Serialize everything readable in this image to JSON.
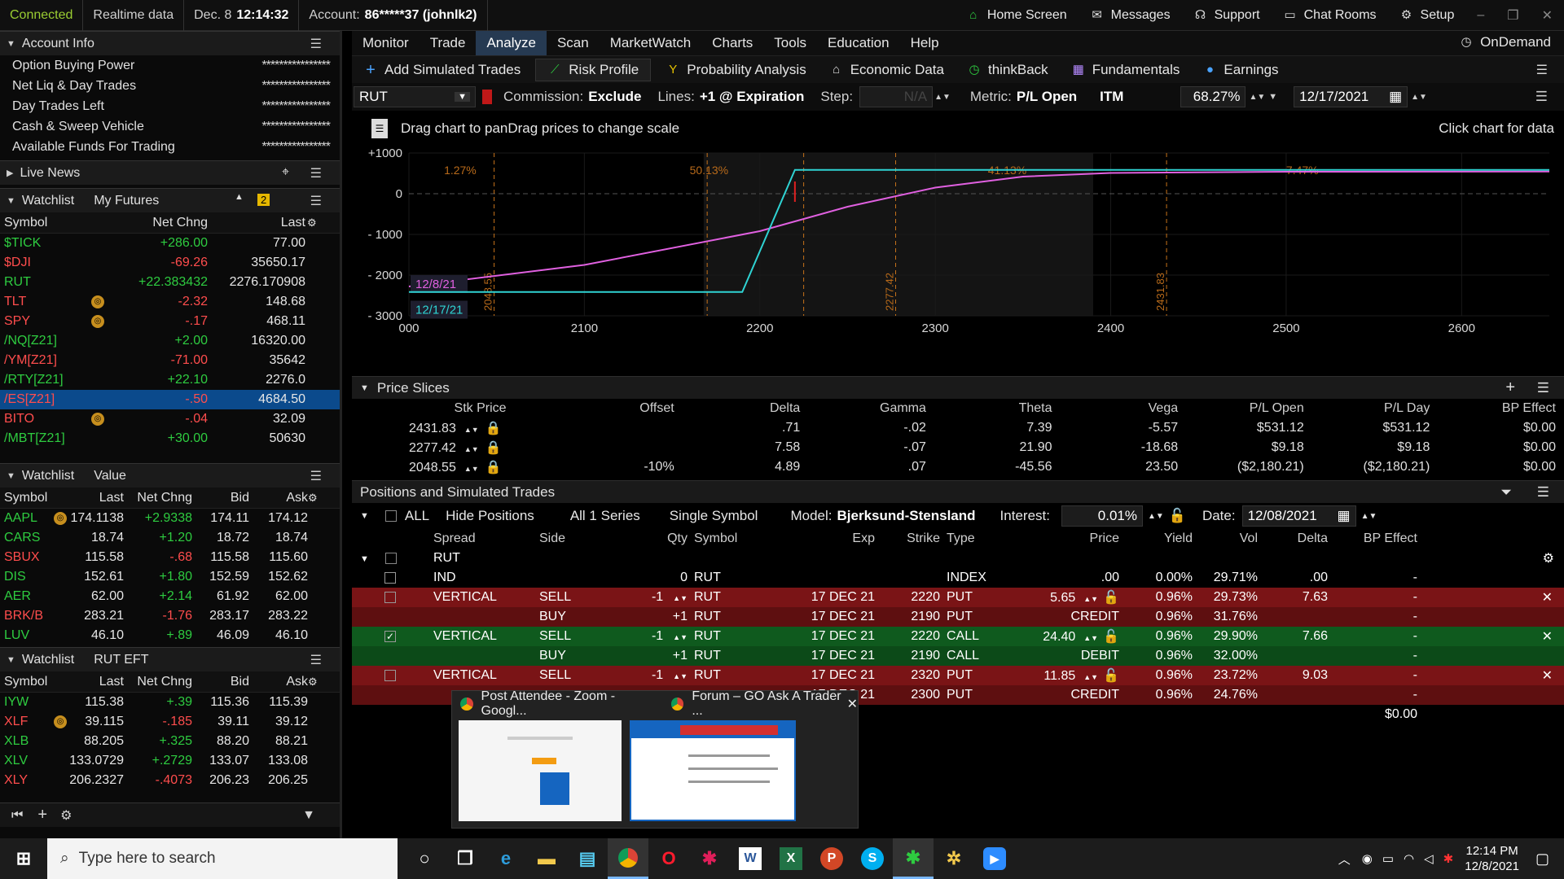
{
  "topbar": {
    "connected": "Connected",
    "realtime": "Realtime data",
    "date": "Dec. 8",
    "time": "12:14:32",
    "account_label": "Account:",
    "account_value": "86*****37 (johnlk2)",
    "home": "Home Screen",
    "messages": "Messages",
    "support": "Support",
    "chat": "Chat Rooms",
    "setup": "Setup"
  },
  "account": {
    "title": "Account Info",
    "rows": [
      {
        "label": "Option Buying Power",
        "value": "****************"
      },
      {
        "label": "Net Liq & Day Trades",
        "value": "****************"
      },
      {
        "label": "Day Trades Left",
        "value": "****************"
      },
      {
        "label": "Cash & Sweep Vehicle",
        "value": "****************"
      },
      {
        "label": "Available Funds For Trading",
        "value": "****************"
      }
    ]
  },
  "news": {
    "title": "Live News"
  },
  "watch1": {
    "title": "Watchlist",
    "list": "My Futures",
    "badge": "2",
    "cols": [
      "Symbol",
      "Net Chng",
      "Last"
    ],
    "rows": [
      {
        "s": "$TICK",
        "c": "+286.00",
        "l": "77.00",
        "d": "pos"
      },
      {
        "s": "$DJI",
        "c": "-69.26",
        "l": "35650.17",
        "d": "neg"
      },
      {
        "s": "RUT",
        "c": "+22.383432",
        "l": "2276.170908",
        "d": "pos"
      },
      {
        "s": "TLT",
        "c": "-2.32",
        "l": "148.68",
        "d": "neg"
      },
      {
        "s": "SPY",
        "c": "-.17",
        "l": "468.11",
        "d": "neg"
      },
      {
        "s": "/NQ[Z21]",
        "c": "+2.00",
        "l": "16320.00",
        "d": "pos"
      },
      {
        "s": "/YM[Z21]",
        "c": "-71.00",
        "l": "35642",
        "d": "neg"
      },
      {
        "s": "/RTY[Z21]",
        "c": "+22.10",
        "l": "2276.0",
        "d": "pos"
      },
      {
        "s": "/ES[Z21]",
        "c": "-.50",
        "l": "4684.50",
        "d": "neg"
      },
      {
        "s": "BITO",
        "c": "-.04",
        "l": "32.09",
        "d": "neg"
      },
      {
        "s": "/MBT[Z21]",
        "c": "+30.00",
        "l": "50630",
        "d": "pos"
      }
    ]
  },
  "watch2": {
    "title": "Watchlist",
    "list": "Value",
    "cols": [
      "Symbol",
      "Last",
      "Net Chng",
      "Bid",
      "Ask"
    ],
    "rows": [
      {
        "s": "AAPL",
        "l": "174.1138",
        "c": "+2.9338",
        "b": "174.11",
        "a": "174.12",
        "d": "pos"
      },
      {
        "s": "CARS",
        "l": "18.74",
        "c": "+1.20",
        "b": "18.72",
        "a": "18.74",
        "d": "pos"
      },
      {
        "s": "SBUX",
        "l": "115.58",
        "c": "-.68",
        "b": "115.58",
        "a": "115.60",
        "d": "neg"
      },
      {
        "s": "DIS",
        "l": "152.61",
        "c": "+1.80",
        "b": "152.59",
        "a": "152.62",
        "d": "pos"
      },
      {
        "s": "AER",
        "l": "62.00",
        "c": "+2.14",
        "b": "61.92",
        "a": "62.00",
        "d": "pos"
      },
      {
        "s": "BRK/B",
        "l": "283.21",
        "c": "-1.76",
        "b": "283.17",
        "a": "283.22",
        "d": "neg"
      },
      {
        "s": "LUV",
        "l": "46.10",
        "c": "+.89",
        "b": "46.09",
        "a": "46.10",
        "d": "pos"
      }
    ]
  },
  "watch3": {
    "title": "Watchlist",
    "list": "RUT EFT",
    "cols": [
      "Symbol",
      "Last",
      "Net Chng",
      "Bid",
      "Ask"
    ],
    "rows": [
      {
        "s": "IYW",
        "l": "115.38",
        "c": "+.39",
        "b": "115.36",
        "a": "115.39",
        "d": "pos"
      },
      {
        "s": "XLF",
        "l": "39.115",
        "c": "-.185",
        "b": "39.11",
        "a": "39.12",
        "d": "neg"
      },
      {
        "s": "XLB",
        "l": "88.205",
        "c": "+.325",
        "b": "88.20",
        "a": "88.21",
        "d": "pos"
      },
      {
        "s": "XLV",
        "l": "133.0729",
        "c": "+.2729",
        "b": "133.07",
        "a": "133.08",
        "d": "pos"
      },
      {
        "s": "XLY",
        "l": "206.2327",
        "c": "-.4073",
        "b": "206.23",
        "a": "206.25",
        "d": "neg"
      }
    ]
  },
  "menu": [
    "Monitor",
    "Trade",
    "Analyze",
    "Scan",
    "MarketWatch",
    "Charts",
    "Tools",
    "Education",
    "Help"
  ],
  "ondemand": "OnDemand",
  "tools": [
    "Add Simulated Trades",
    "Risk Profile",
    "Probability Analysis",
    "Economic Data",
    "thinkBack",
    "Fundamentals",
    "Earnings"
  ],
  "controls": {
    "symbol": "RUT",
    "commission_label": "Commission:",
    "commission": "Exclude",
    "lines_label": "Lines:",
    "lines": "+1 @ Expiration",
    "step_label": "Step:",
    "step": "N/A",
    "metric_label": "Metric:",
    "metric": "P/L Open",
    "itm": "ITM",
    "pct": "68.27%",
    "date": "12/17/2021"
  },
  "chart_hint_left": "Drag chart to panDrag prices to change scale",
  "chart_hint_right": "Click chart for data",
  "chart_data": {
    "type": "line",
    "x_ticks": [
      "000",
      "2100",
      "2200",
      "2300",
      "2400",
      "2500",
      "2600"
    ],
    "y_ticks": [
      "+1000",
      "0",
      "- 1000",
      "- 2000",
      "- 3000"
    ],
    "xlim": [
      2000,
      2650
    ],
    "ylim": [
      -3000,
      1000
    ],
    "series": [
      {
        "name": "12/8/21",
        "color": "#e060e0",
        "x": [
          2000,
          2100,
          2200,
          2250,
          2300,
          2350,
          2400,
          2500,
          2650
        ],
        "y": [
          -2280,
          -1750,
          -920,
          -320,
          150,
          420,
          510,
          540,
          545
        ]
      },
      {
        "name": "12/17/21",
        "color": "#2fd3d3",
        "x": [
          2000,
          2190,
          2220,
          2650
        ],
        "y": [
          -2415,
          -2415,
          585,
          585
        ]
      }
    ],
    "zone_pcts": [
      "1.27%",
      "50.13%",
      "41.13%",
      "7.47%"
    ],
    "slice_prices": [
      "2048.55",
      "2277.42",
      "2431.83"
    ]
  },
  "price_slices": {
    "title": "Price Slices",
    "cols": [
      "Stk Price",
      "Offset",
      "Delta",
      "Gamma",
      "Theta",
      "Vega",
      "P/L Open",
      "P/L Day",
      "BP Effect"
    ],
    "rows": [
      {
        "p": "2431.83",
        "off": "",
        "delta": ".71",
        "gamma": "-.02",
        "theta": "7.39",
        "vega": "-5.57",
        "plo": "$531.12",
        "pld": "$531.12",
        "bp": "$0.00"
      },
      {
        "p": "2277.42",
        "off": "",
        "delta": "7.58",
        "gamma": "-.07",
        "theta": "21.90",
        "vega": "-18.68",
        "plo": "$9.18",
        "pld": "$9.18",
        "bp": "$0.00"
      },
      {
        "p": "2048.55",
        "off": "-10%",
        "delta": "4.89",
        "gamma": ".07",
        "theta": "-45.56",
        "vega": "23.50",
        "plo": "($2,180.21)",
        "pld": "($2,180.21)",
        "bp": "$0.00"
      }
    ]
  },
  "positions": {
    "title": "Positions and Simulated Trades",
    "all": "ALL",
    "hide": "Hide Positions",
    "series": "All 1 Series",
    "single": "Single Symbol",
    "model_label": "Model:",
    "model": "Bjerksund-Stensland",
    "interest_label": "Interest:",
    "interest": "0.01%",
    "date_label": "Date:",
    "date": "12/08/2021",
    "cols": [
      "Spread",
      "Side",
      "Qty",
      "Symbol",
      "Exp",
      "Strike",
      "Type",
      "Price",
      "Yield",
      "Vol",
      "Delta",
      "BP Effect"
    ],
    "group": "RUT",
    "rows": [
      {
        "spread": "IND",
        "side": "",
        "qty": "0",
        "sym": "RUT",
        "exp": "",
        "strike": "",
        "type": "INDEX",
        "price": ".00",
        "yield": "0.00%",
        "vol": "29.71%",
        "delta": ".00",
        "bp": "-",
        "cls": ""
      },
      {
        "spread": "VERTICAL",
        "side": "SELL",
        "qty": "-1",
        "sym": "RUT",
        "exp": "17 DEC 21",
        "strike": "2220",
        "type": "PUT",
        "price": "5.65",
        "yield": "0.96%",
        "vol": "29.73%",
        "delta": "7.63",
        "bp": "-",
        "cls": "red"
      },
      {
        "spread": "",
        "side": "BUY",
        "qty": "+1",
        "sym": "RUT",
        "exp": "17 DEC 21",
        "strike": "2190",
        "type": "PUT",
        "price": "CREDIT",
        "yield": "0.96%",
        "vol": "31.76%",
        "delta": "",
        "bp": "-",
        "cls": "sub-red"
      },
      {
        "spread": "VERTICAL",
        "side": "SELL",
        "qty": "-1",
        "sym": "RUT",
        "exp": "17 DEC 21",
        "strike": "2220",
        "type": "CALL",
        "price": "24.40",
        "yield": "0.96%",
        "vol": "29.90%",
        "delta": "7.66",
        "bp": "-",
        "cls": "grn"
      },
      {
        "spread": "",
        "side": "BUY",
        "qty": "+1",
        "sym": "RUT",
        "exp": "17 DEC 21",
        "strike": "2190",
        "type": "CALL",
        "price": "DEBIT",
        "yield": "0.96%",
        "vol": "32.00%",
        "delta": "",
        "bp": "-",
        "cls": "sub-grn"
      },
      {
        "spread": "VERTICAL",
        "side": "SELL",
        "qty": "-1",
        "sym": "RUT",
        "exp": "17 DEC 21",
        "strike": "2320",
        "type": "PUT",
        "price": "11.85",
        "yield": "0.96%",
        "vol": "23.72%",
        "delta": "9.03",
        "bp": "-",
        "cls": "red"
      },
      {
        "spread": "",
        "side": "",
        "qty": "",
        "sym": "",
        "exp": "17 DEC 21",
        "strike": "2300",
        "type": "PUT",
        "price": "CREDIT",
        "yield": "0.96%",
        "vol": "24.76%",
        "delta": "",
        "bp": "-",
        "cls": "sub-red"
      }
    ],
    "total": "$0.00"
  },
  "popup": {
    "win1": "Post Attendee - Zoom - Googl...",
    "win2": "Forum – GO Ask A Trader ..."
  },
  "taskbar": {
    "search": "Type here to search",
    "time": "12:14 PM",
    "date": "12/8/2021"
  }
}
